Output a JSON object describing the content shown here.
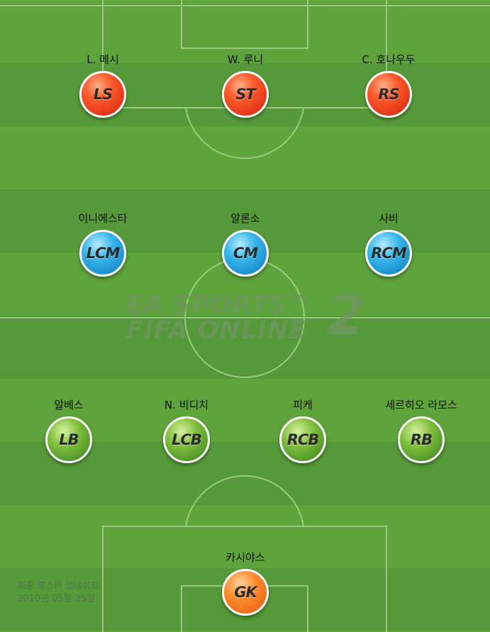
{
  "watermark": {
    "line1": "EA SPORTS™",
    "line2": "FIFA ONLINE",
    "number": "2"
  },
  "forwards": [
    {
      "name": "L. 메시",
      "position": "LS",
      "color": "#e8321a"
    },
    {
      "name": "W. 루니",
      "position": "ST",
      "color": "#e8321a"
    },
    {
      "name": "C. 호나우두",
      "position": "RS",
      "color": "#e8321a"
    }
  ],
  "midfielders": [
    {
      "name": "이니에스타",
      "position": "LCM",
      "color": "#2aa4e0"
    },
    {
      "name": "알론소",
      "position": "CM",
      "color": "#2aa4e0"
    },
    {
      "name": "사비",
      "position": "RCM",
      "color": "#2aa4e0"
    }
  ],
  "defenders": [
    {
      "name": "알베스",
      "position": "LB",
      "color": "#5aa62c"
    },
    {
      "name": "N. 비디치",
      "position": "LCB",
      "color": "#5aa62c"
    },
    {
      "name": "피케",
      "position": "RCB",
      "color": "#5aa62c"
    },
    {
      "name": "세르히오 라모스",
      "position": "RB",
      "color": "#5aa62c"
    }
  ],
  "goalkeeper": {
    "name": "카시야스",
    "position": "GK",
    "color": "#f47a1e"
  },
  "roster_update": {
    "line1": "최종 로스터 업데이트",
    "line2": "2010년 05월 25일"
  }
}
